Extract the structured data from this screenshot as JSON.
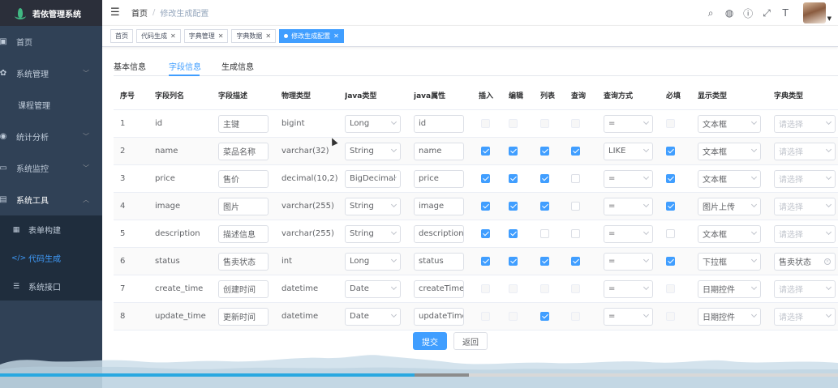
{
  "app": {
    "title": "若依管理系统"
  },
  "sidebar": {
    "items": [
      {
        "label": "首页",
        "icon": "dashboard-icon"
      },
      {
        "label": "系统管理",
        "icon": "gear-icon",
        "arrow": "chevron-down-icon"
      },
      {
        "label": "课程管理"
      },
      {
        "label": "统计分析",
        "icon": "chart-icon",
        "arrow": "chevron-down-icon"
      },
      {
        "label": "系统监控",
        "icon": "monitor-icon",
        "arrow": "chevron-down-icon"
      },
      {
        "label": "系统工具",
        "icon": "toolbox-icon",
        "arrow": "chevron-up-icon"
      }
    ],
    "sub_items": [
      {
        "label": "表单构建",
        "icon": "form-icon"
      },
      {
        "label": "代码生成",
        "icon": "code-icon"
      },
      {
        "label": "系统接口",
        "icon": "api-icon"
      }
    ]
  },
  "header": {
    "breadcrumb_home": "首页",
    "breadcrumb_sep": "/",
    "breadcrumb_current": "修改生成配置"
  },
  "tags": [
    {
      "label": "首页"
    },
    {
      "label": "代码生成"
    },
    {
      "label": "字典管理"
    },
    {
      "label": "字典数据"
    },
    {
      "label": "修改生成配置"
    }
  ],
  "tabs": [
    "基本信息",
    "字段信息",
    "生成信息"
  ],
  "table": {
    "columns": [
      "序号",
      "字段列名",
      "字段描述",
      "物理类型",
      "Java类型",
      "java属性",
      "插入",
      "编辑",
      "列表",
      "查询",
      "查询方式",
      "必填",
      "显示类型",
      "字典类型"
    ],
    "rows": [
      {
        "no": "1",
        "column": "id",
        "desc": "主键",
        "phys": "bigint",
        "jtype": "Long",
        "jprop": "id",
        "ins": false,
        "edit": false,
        "list": false,
        "query": false,
        "qtype": "=",
        "req": false,
        "html": "文本框",
        "dict": "请选择",
        "dict_ph": true
      },
      {
        "no": "2",
        "column": "name",
        "desc": "菜品名称",
        "phys": "varchar(32)",
        "jtype": "String",
        "jprop": "name",
        "ins": true,
        "edit": true,
        "list": true,
        "query": true,
        "qtype": "LIKE",
        "req": true,
        "html": "文本框",
        "dict": "请选择",
        "dict_ph": true
      },
      {
        "no": "3",
        "column": "price",
        "desc": "售价",
        "phys": "decimal(10,2)",
        "jtype": "BigDecimal",
        "jprop": "price",
        "ins": true,
        "edit": true,
        "list": true,
        "query": false,
        "qtype": "=",
        "req": true,
        "html": "文本框",
        "dict": "请选择",
        "dict_ph": true
      },
      {
        "no": "4",
        "column": "image",
        "desc": "图片",
        "phys": "varchar(255)",
        "jtype": "String",
        "jprop": "image",
        "ins": true,
        "edit": true,
        "list": true,
        "query": false,
        "qtype": "=",
        "req": true,
        "html": "图片上传",
        "dict": "请选择",
        "dict_ph": true
      },
      {
        "no": "5",
        "column": "description",
        "desc": "描述信息",
        "phys": "varchar(255)",
        "jtype": "String",
        "jprop": "description",
        "ins": true,
        "edit": true,
        "list": false,
        "query": false,
        "qtype": "=",
        "req": false,
        "html": "文本框",
        "dict": "请选择",
        "dict_ph": true
      },
      {
        "no": "6",
        "column": "status",
        "desc": "售卖状态",
        "phys": "int",
        "jtype": "Long",
        "jprop": "status",
        "ins": true,
        "edit": true,
        "list": true,
        "query": true,
        "qtype": "=",
        "req": true,
        "html": "下拉框",
        "dict": "售卖状态",
        "dict_ph": false
      },
      {
        "no": "7",
        "column": "create_time",
        "desc": "创建时间",
        "phys": "datetime",
        "jtype": "Date",
        "jprop": "createTime",
        "ins": false,
        "edit": false,
        "list": false,
        "query": false,
        "qtype": "=",
        "req": false,
        "html": "日期控件",
        "dict": "请选择",
        "dict_ph": true
      },
      {
        "no": "8",
        "column": "update_time",
        "desc": "更新时间",
        "phys": "datetime",
        "jtype": "Date",
        "jprop": "updateTime",
        "ins": false,
        "edit": false,
        "list": true,
        "query": false,
        "qtype": "=",
        "req": false,
        "html": "日期控件",
        "dict": "请选择",
        "dict_ph": true
      }
    ]
  },
  "actions": {
    "submit": "提交",
    "back": "返回"
  },
  "colors": {
    "accent": "#409eff",
    "sidebar_bg": "#304156",
    "sidebar_sub_bg": "#1f2d3d"
  }
}
